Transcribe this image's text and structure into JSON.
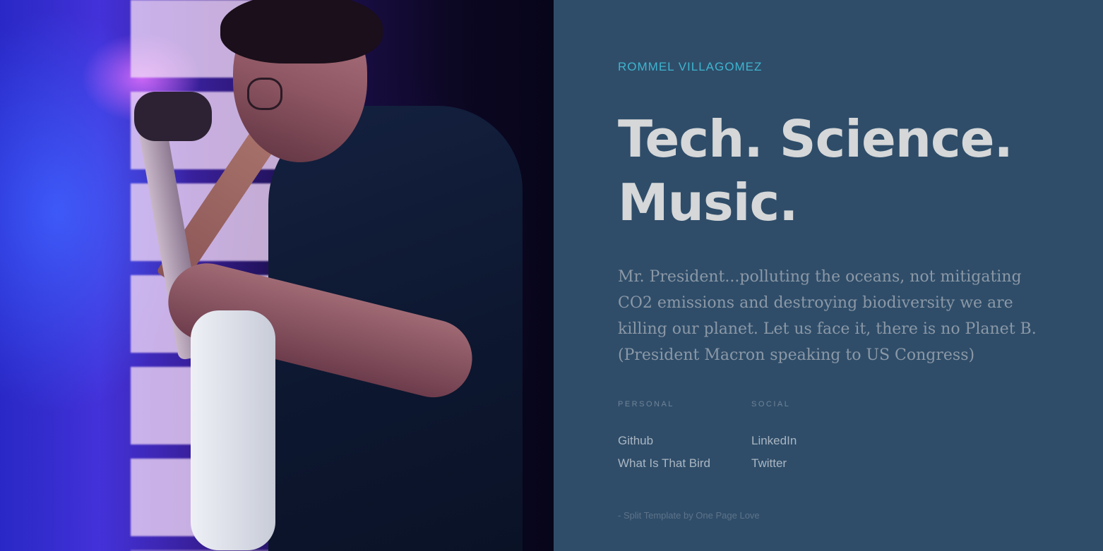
{
  "hero_photo": {
    "alt": "Guitarist performing on stage under purple and blue lights",
    "colors": {
      "primary": "#2a1ea8",
      "magenta_light": "#ff78ff",
      "shadow": "#07051a"
    }
  },
  "header": {
    "name": "ROMMEL VILLAGOMEZ"
  },
  "main": {
    "headline_line1": "Tech. Science.",
    "headline_line2": "Music.",
    "quote": "Mr. President...polluting the oceans, not mitigating CO2 emissions and destroying biodiversity we are killing our planet. Let us face it, there is no Planet B. (President Macron speaking to US Congress)"
  },
  "links": {
    "personal": {
      "heading": "PERSONAL",
      "items": [
        {
          "label": "Github"
        },
        {
          "label": "What Is That Bird"
        }
      ]
    },
    "social": {
      "heading": "SOCIAL",
      "items": [
        {
          "label": "LinkedIn"
        },
        {
          "label": "Twitter"
        }
      ]
    }
  },
  "footer": {
    "credit": "- Split Template by One Page Love"
  },
  "colors": {
    "panel_background": "#2f4d69",
    "accent": "#3fb4cf",
    "headline": "#d5d7d8",
    "body_text": "#8b98a6"
  }
}
